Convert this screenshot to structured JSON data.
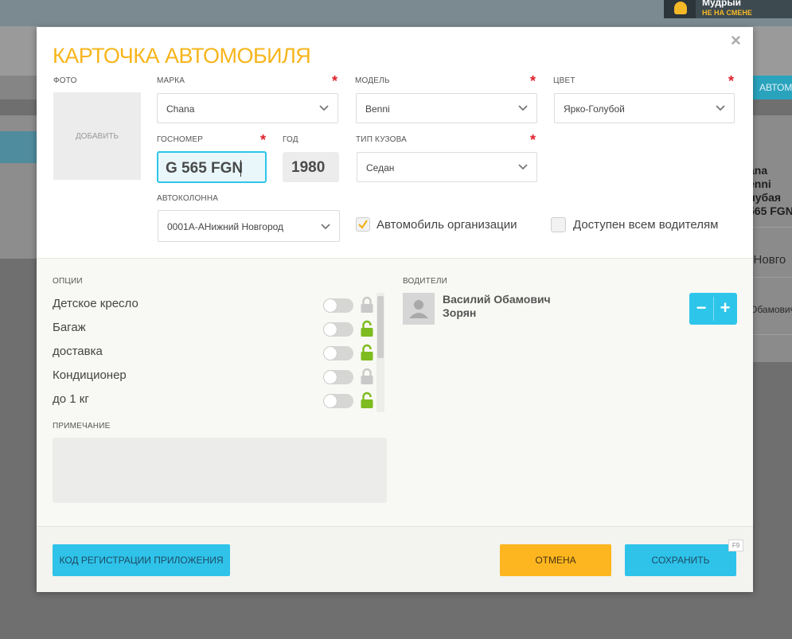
{
  "background": {
    "user": {
      "name": "Мудрый",
      "status": "НЕ НА СМЕНЕ"
    },
    "button_label": "АВТОМ",
    "right_lines": [
      "ana",
      "enni",
      "лубая",
      "565 FGN"
    ],
    "right_city": "й Новго",
    "right_driver": "Обамович"
  },
  "modal": {
    "title": "КАРТОЧКА АВТОМОБИЛЯ",
    "close_icon": "×",
    "photo": {
      "label": "ФОТО",
      "add_label": "ДОБАВИТЬ"
    },
    "fields": {
      "brand": {
        "label": "МАРКА",
        "value": "Chana",
        "required": true
      },
      "model": {
        "label": "МОДЕЛЬ",
        "value": "Benni",
        "required": true
      },
      "color": {
        "label": "ЦВЕТ",
        "value": "Ярко-Голубой",
        "required": true
      },
      "plate": {
        "label": "ГОСНОМЕР",
        "value": "G 565 FGN",
        "required": true
      },
      "year": {
        "label": "ГОД",
        "value": "1980"
      },
      "body": {
        "label": "ТИП КУЗОВА",
        "value": "Седан",
        "required": true
      },
      "fleet": {
        "label": "АВТОКОЛОННА",
        "value": "0001А-АНижний Новгород"
      }
    },
    "checkboxes": {
      "org_car": {
        "label": "Автомобиль организации",
        "checked": true
      },
      "all_drivers": {
        "label": "Доступен всем водителям",
        "checked": false
      }
    },
    "options": {
      "label": "ОПЦИИ",
      "items": [
        {
          "label": "Детское кресло",
          "on": false,
          "lock": "locked"
        },
        {
          "label": "Багаж",
          "on": false,
          "lock": "unlocked"
        },
        {
          "label": "доставка",
          "on": false,
          "lock": "unlocked"
        },
        {
          "label": "Кондиционер",
          "on": false,
          "lock": "locked"
        },
        {
          "label": "до 1 кг",
          "on": false,
          "lock": "unlocked"
        }
      ]
    },
    "note": {
      "label": "ПРИМЕЧАНИЕ",
      "value": ""
    },
    "drivers": {
      "label": "ВОДИТЕЛИ",
      "items": [
        {
          "name_line1": "Василий Обамович",
          "name_line2": "Зорян"
        }
      ],
      "minus": "−",
      "plus": "+"
    },
    "buttons": {
      "register": "КОД РЕГИСТРАЦИИ ПРИЛОЖЕНИЯ",
      "cancel": "ОТМЕНА",
      "save": "СОХРАНИТЬ",
      "save_hotkey": "F9"
    },
    "colors": {
      "accent_yellow": "#f7b51c",
      "accent_blue": "#2fc3ea",
      "required_red": "#e0202a",
      "lock_green": "#7dbb1e",
      "lock_grey": "#c9c9c9"
    }
  }
}
